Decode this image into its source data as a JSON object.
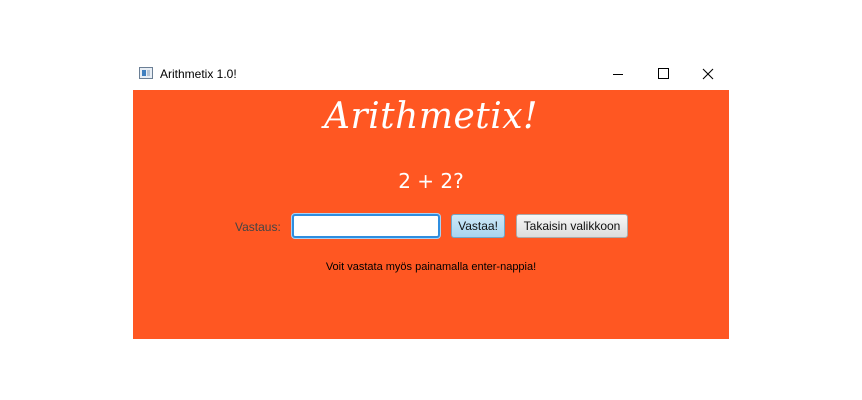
{
  "window": {
    "title": "Arithmetix 1.0!",
    "controls": {
      "minimize_icon": "minimize-icon",
      "maximize_icon": "maximize-icon",
      "close_icon": "close-icon"
    }
  },
  "colors": {
    "background": "#ff5722",
    "text_light": "#ffffff",
    "accent_button": "#a8d5ef",
    "input_focus": "#2f8ee0"
  },
  "main": {
    "logo": "Arithmetix!",
    "question": "2 + 2?",
    "answer_label": "Vastaus:",
    "answer_value": "",
    "submit_button": "Vastaa!",
    "back_button": "Takaisin valikkoon",
    "hint": "Voit vastata myös painamalla enter-nappia!"
  }
}
